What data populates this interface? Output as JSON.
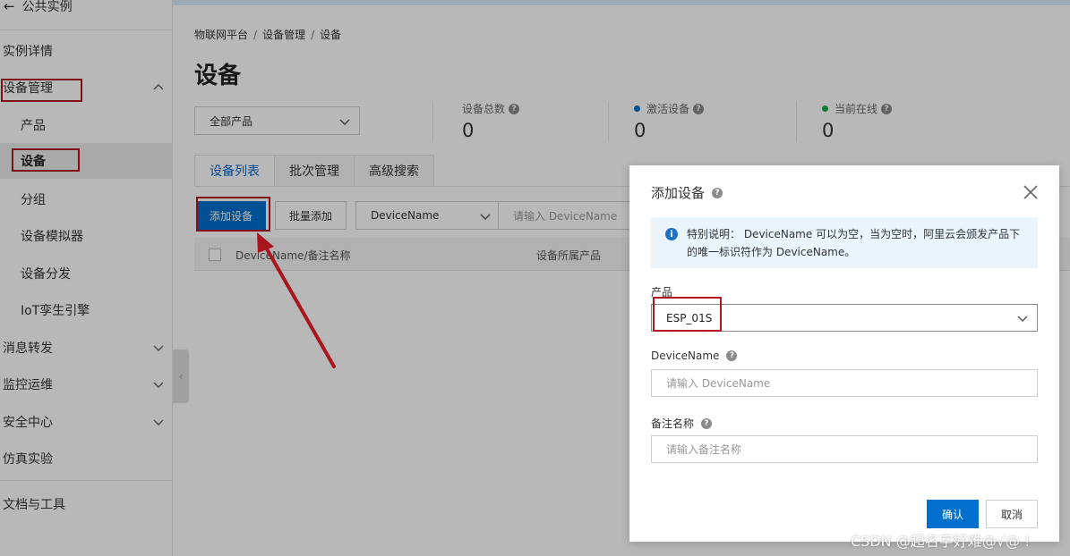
{
  "sidebar": {
    "back_label": "公共实例",
    "items": [
      {
        "label": "实例详情"
      },
      {
        "label": "设备管理"
      },
      {
        "label": "产品"
      },
      {
        "label": "设备"
      },
      {
        "label": "分组"
      },
      {
        "label": "设备模拟器"
      },
      {
        "label": "设备分发"
      },
      {
        "label": "IoT孪生引擎"
      },
      {
        "label": "消息转发"
      },
      {
        "label": "监控运维"
      },
      {
        "label": "安全中心"
      },
      {
        "label": "仿真实验"
      },
      {
        "label": "文档与工具"
      }
    ]
  },
  "main": {
    "breadcrumb": [
      "物联网平台",
      "设备管理",
      "设备"
    ],
    "page_title": "设备",
    "product_filter": "全部产品",
    "stats": [
      {
        "label": "设备总数",
        "value": "0"
      },
      {
        "label": "激活设备",
        "value": "0",
        "dot_color": "#0070cc"
      },
      {
        "label": "当前在线",
        "value": "0",
        "dot_color": "#1ca84a"
      }
    ],
    "tabs": [
      "设备列表",
      "批次管理",
      "高级搜索"
    ],
    "add_button": "添加设备",
    "batch_button": "批量添加",
    "field_select": "DeviceName",
    "search_placeholder": "请输入 DeviceName",
    "columns": [
      "DeviceName/备注名称",
      "设备所属产品"
    ]
  },
  "dialog": {
    "title": "添加设备",
    "notice": "特别说明： DeviceName 可以为空，当为空时，阿里云会颁发产品下的唯一标识符作为 DeviceName。",
    "product_label": "产品",
    "product_value": "ESP_01S",
    "devicename_label": "DeviceName",
    "devicename_placeholder": "请输入 DeviceName",
    "remark_label": "备注名称",
    "remark_placeholder": "请输入备注名称",
    "confirm": "确认",
    "cancel": "取消"
  },
  "watermark": "CSDN @起名字好难@√@ !",
  "colors": {
    "accent": "#0070cc",
    "annotation": "#b4161f"
  }
}
